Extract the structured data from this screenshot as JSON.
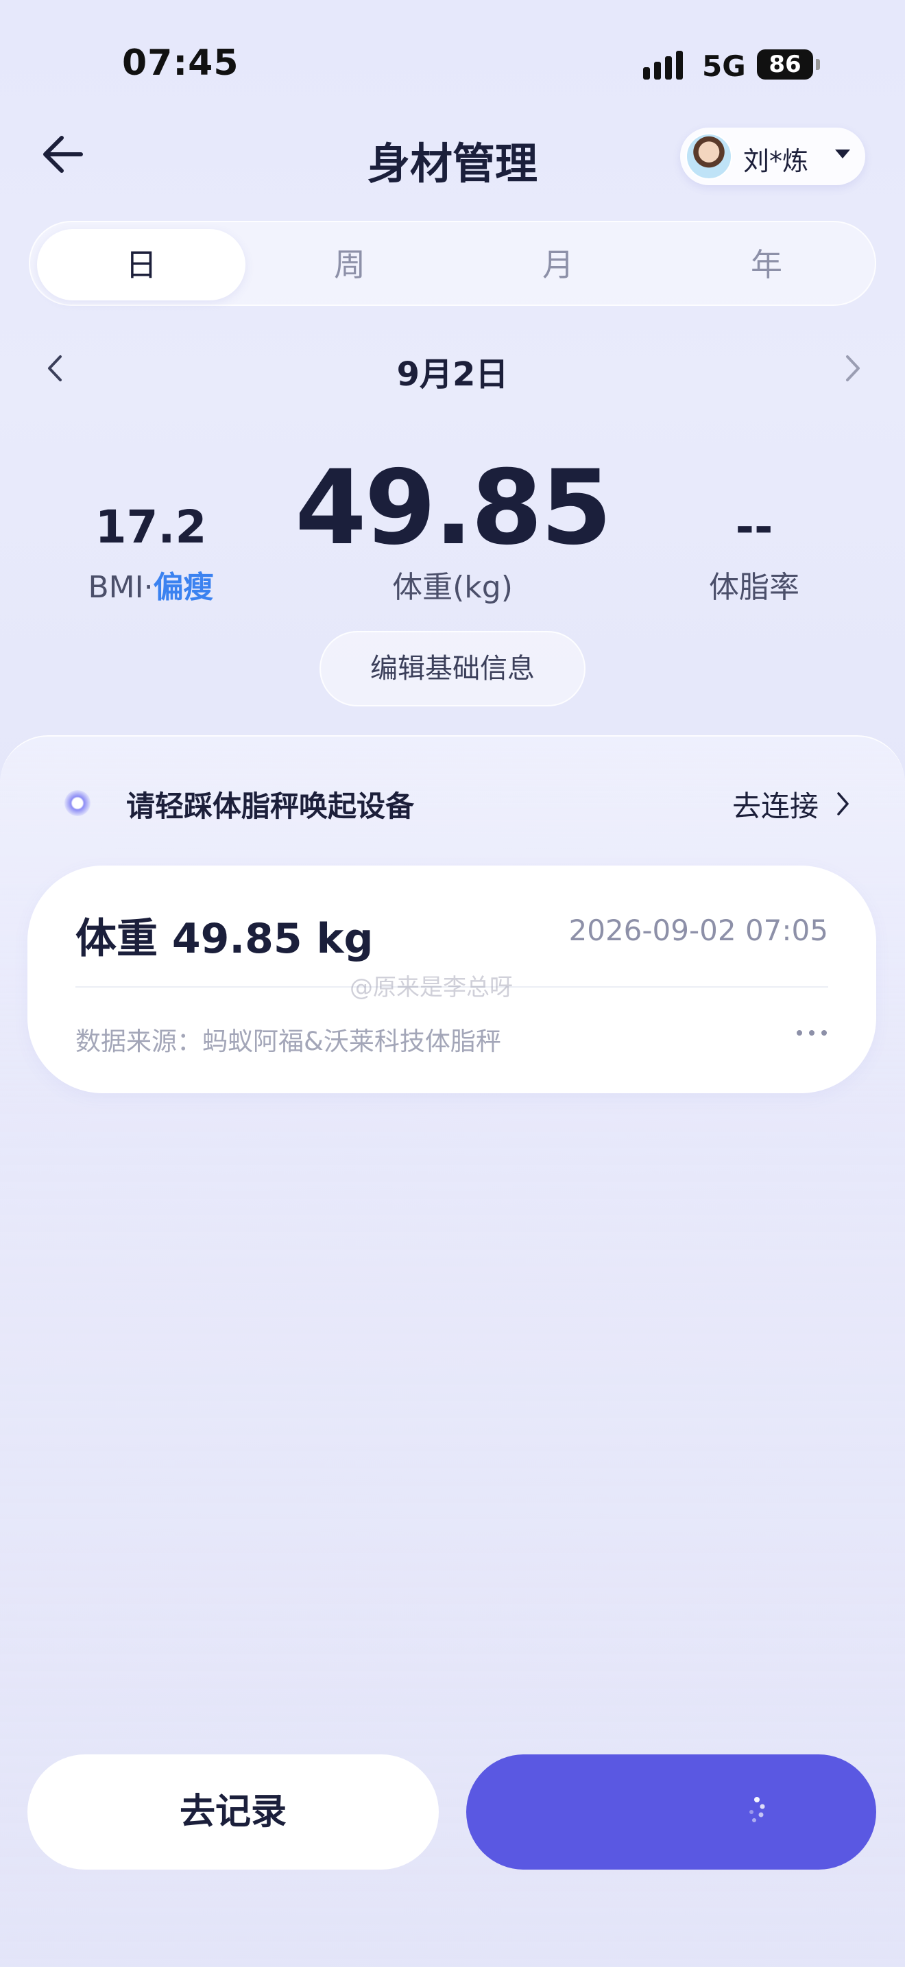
{
  "status_bar": {
    "time": "07:45",
    "network": "5G",
    "battery": "86"
  },
  "header": {
    "title": "身材管理",
    "user_name": "刘*炼"
  },
  "tabs": [
    {
      "label": "日",
      "active": true
    },
    {
      "label": "周",
      "active": false
    },
    {
      "label": "月",
      "active": false
    },
    {
      "label": "年",
      "active": false
    }
  ],
  "date_nav": {
    "date": "9月2日"
  },
  "metrics": {
    "bmi_value": "17.2",
    "bmi_label": "BMI",
    "bmi_separator": "·",
    "bmi_status": "偏瘦",
    "weight_value": "49.85",
    "weight_label": "体重(kg)",
    "fat_value": "--",
    "fat_label": "体脂率"
  },
  "edit_button": "编辑基础信息",
  "device": {
    "hint": "请轻踩体脂秤唤起设备",
    "connect": "去连接"
  },
  "record": {
    "weight": "体重 49.85 kg",
    "time": "2026-09-02 07:05",
    "source": "数据来源：蚂蚁阿福&沃莱科技体脂秤"
  },
  "watermark": "@原来是李总呀",
  "buttons": {
    "record": "去记录"
  },
  "colors": {
    "accent": "#5a58e2",
    "bmi_status": "#3b82f0"
  }
}
